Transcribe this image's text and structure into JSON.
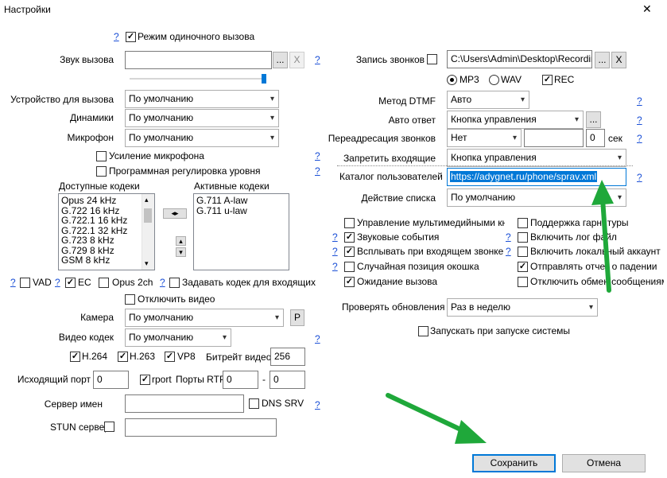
{
  "window": {
    "title": "Настройки",
    "close_symbol": "✕"
  },
  "left": {
    "single_call_mode": {
      "label": "Режим одиночного вызова",
      "checked": true
    },
    "call_sound": {
      "label": "Звук вызова",
      "value": "",
      "browse": "...",
      "clear": "X"
    },
    "call_device": {
      "label": "Устройство для вызова",
      "value": "По умолчанию"
    },
    "speakers": {
      "label": "Динамики",
      "value": "По умолчанию"
    },
    "microphone": {
      "label": "Микрофон",
      "value": "По умолчанию"
    },
    "mic_boost": {
      "label": "Усиление микрофона",
      "checked": false
    },
    "soft_level": {
      "label": "Программная регулировка уровня",
      "checked": false
    },
    "available_codecs": {
      "label": "Доступные кодеки",
      "items": [
        "Opus 24 kHz",
        "G.722 16 kHz",
        "G.722.1 16 kHz",
        "G.722.1 32 kHz",
        "G.723 8 kHz",
        "G.729 8 kHz",
        "GSM 8 kHz"
      ]
    },
    "active_codecs": {
      "label": "Активные кодеки",
      "items": [
        "G.711 A-law",
        "G.711 u-law"
      ]
    },
    "vad": {
      "label": "VAD",
      "checked": false
    },
    "ec": {
      "label": "EC",
      "checked": true
    },
    "opus2ch": {
      "label": "Opus 2ch",
      "checked": false
    },
    "incoming_codec": {
      "label": "Задавать кодек для входящих",
      "checked": false
    },
    "disable_video": {
      "label": "Отключить видео",
      "checked": false
    },
    "camera": {
      "label": "Камера",
      "value": "По умолчанию",
      "btn": "P"
    },
    "video_codec": {
      "label": "Видео кодек",
      "value": "По умолчанию"
    },
    "h264": {
      "label": "H.264",
      "checked": true
    },
    "h263": {
      "label": "H.263",
      "checked": true
    },
    "vp8": {
      "label": "VP8",
      "checked": true
    },
    "bitrate": {
      "label": "Битрейт видео",
      "value": "256"
    },
    "out_port": {
      "label": "Исходящий порт",
      "value": "0"
    },
    "rport": {
      "label": "rport",
      "checked": true
    },
    "rtp_ports": {
      "label": "Порты RTP",
      "from": "0",
      "dash": "-",
      "to": "0"
    },
    "name_server": {
      "label": "Сервер имен",
      "value": ""
    },
    "dns_srv": {
      "label": "DNS SRV",
      "checked": false
    },
    "stun": {
      "label": "STUN сервер",
      "checked": false,
      "value": ""
    }
  },
  "right": {
    "record": {
      "label": "Запись звонков",
      "checked": false,
      "path": "C:\\Users\\Admin\\Desktop\\Recordings",
      "browse": "...",
      "clear": "X"
    },
    "mp3": {
      "label": "MP3",
      "selected": true
    },
    "wav": {
      "label": "WAV",
      "selected": false
    },
    "rec": {
      "label": "REC",
      "checked": true
    },
    "dtmf": {
      "label": "Метод DTMF",
      "value": "Авто"
    },
    "auto_answer": {
      "label": "Авто ответ",
      "value": "Кнопка управления",
      "btn": "..."
    },
    "call_forward": {
      "label": "Переадресация звонков",
      "value": "Нет",
      "seconds": "0",
      "unit": "сек"
    },
    "block_incoming": {
      "label": "Запретить входящие",
      "value": "Кнопка управления"
    },
    "user_catalog": {
      "label": "Каталог пользователей",
      "value": "https://adygnet.ru/phone/sprav.xml"
    },
    "list_action": {
      "label": "Действие списка",
      "value": "По умолчанию"
    },
    "checks": [
      {
        "label": "Управление мультимедийными кнопк",
        "checked": false
      },
      {
        "label": "Поддержка гарнитуры",
        "checked": false
      },
      {
        "label": "Звуковые события",
        "checked": true
      },
      {
        "label": "Включить лог файл",
        "checked": false
      },
      {
        "label": "Всплывать при входящем звонке",
        "checked": true
      },
      {
        "label": "Включить локальный аккаунт",
        "checked": false
      },
      {
        "label": "Случайная позиция окошка",
        "checked": false
      },
      {
        "label": "Отправлять отчет о падении",
        "checked": true
      },
      {
        "label": "Ожидание вызова",
        "checked": true
      },
      {
        "label": "Отключить обмен сообщениями",
        "checked": false
      }
    ],
    "check_updates": {
      "label": "Проверять обновления",
      "value": "Раз в неделю"
    },
    "autostart": {
      "label": "Запускать при запуске системы",
      "checked": false
    }
  },
  "footer": {
    "save": "Сохранить",
    "cancel": "Отмена"
  },
  "help": "?",
  "arrows": {
    "left_right": "◂▸",
    "up": "▴",
    "down": "▾"
  },
  "colors": {
    "accent": "#0078d7",
    "help_link": "#1a4fd6",
    "annotation_arrow": "#1fa83a"
  }
}
